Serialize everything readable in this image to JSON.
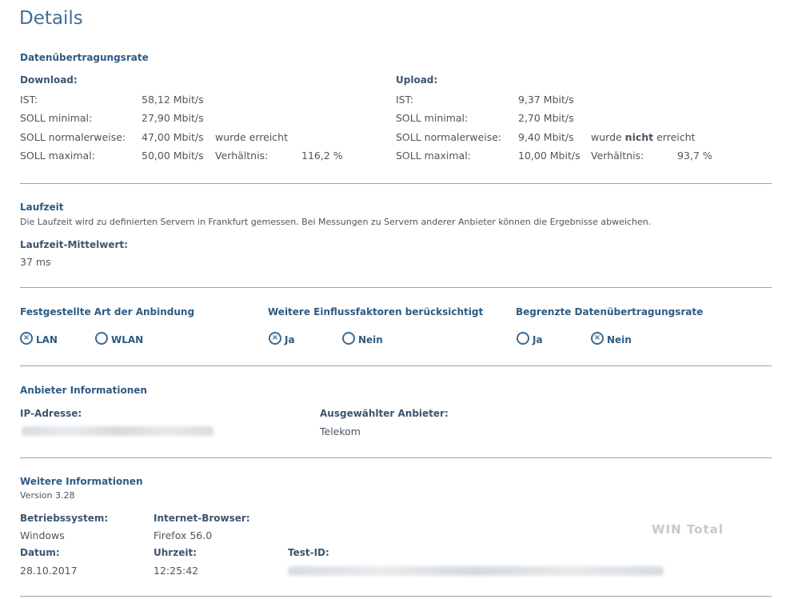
{
  "title": "Details",
  "rate": {
    "heading": "Datenübertragungsrate",
    "download": {
      "label": "Download:",
      "rows": [
        {
          "k": "IST:",
          "v": "58,12 Mbit/s"
        },
        {
          "k": "SOLL minimal:",
          "v": "27,90 Mbit/s"
        },
        {
          "k": "SOLL normalerweise:",
          "v": "47,00 Mbit/s",
          "note": "wurde erreicht"
        },
        {
          "k": "SOLL maximal:",
          "v": "50,00 Mbit/s",
          "note": "Verhältnis:",
          "pct": "116,2 %"
        }
      ]
    },
    "upload": {
      "label": "Upload:",
      "rows": [
        {
          "k": "IST:",
          "v": "9,37 Mbit/s"
        },
        {
          "k": "SOLL minimal:",
          "v": "2,70 Mbit/s"
        },
        {
          "k": "SOLL normalerweise:",
          "v": "9,40 Mbit/s",
          "note_a": "wurde ",
          "note_b": "nicht",
          "note_c": " erreicht"
        },
        {
          "k": "SOLL maximal:",
          "v": "10,00 Mbit/s",
          "note": "Verhältnis:",
          "pct": "93,7 %"
        }
      ]
    }
  },
  "laufzeit": {
    "heading": "Laufzeit",
    "desc": "Die Laufzeit wird zu definierten Servern in Frankfurt gemessen. Bei Messungen zu Servern anderer Anbieter können die Ergebnisse abweichen.",
    "label": "Laufzeit-Mittelwert:",
    "value": "37 ms"
  },
  "options": [
    {
      "heading": "Festgestellte Art der Anbindung",
      "a": "LAN",
      "b": "WLAN",
      "selected": "a"
    },
    {
      "heading": "Weitere Einflussfaktoren berücksichtigt",
      "a": "Ja",
      "b": "Nein",
      "selected": "a"
    },
    {
      "heading": "Begrenzte Datenübertragungsrate",
      "a": "Ja",
      "b": "Nein",
      "selected": "b"
    }
  ],
  "radio_mark": "×",
  "anbieter": {
    "heading": "Anbieter Informationen",
    "ip_label": "IP-Adresse:",
    "provider_label": "Ausgewählter Anbieter:",
    "provider": "Telekom"
  },
  "weitere": {
    "heading": "Weitere Informationen",
    "version": "Version 3.28",
    "os_label": "Betriebssystem:",
    "os": "Windows",
    "browser_label": "Internet-Browser:",
    "browser": "Firefox 56.0",
    "date_label": "Datum:",
    "date": "28.10.2017",
    "time_label": "Uhrzeit:",
    "time": "12:25:42",
    "testid_label": "Test-ID:"
  },
  "watermark": "WIN Total"
}
